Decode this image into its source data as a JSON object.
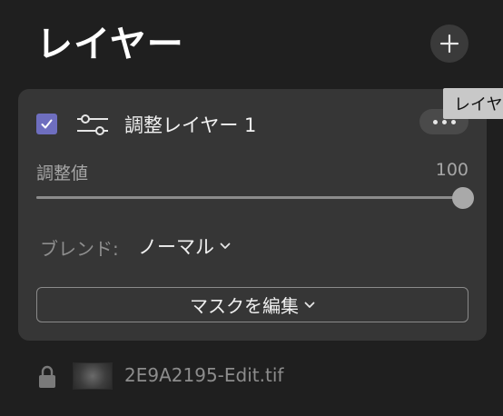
{
  "panel": {
    "title": "レイヤー"
  },
  "layer": {
    "checked": true,
    "name": "調整レイヤー 1",
    "adjustment": {
      "label": "調整値",
      "value": "100",
      "percent": 100
    },
    "blend": {
      "label": "ブレンド:",
      "value": "ノーマル"
    },
    "mask_button": "マスクを編集"
  },
  "base_layer": {
    "file_name": "2E9A2195-Edit.tif",
    "locked": true
  },
  "tooltip": {
    "text": "レイヤ"
  },
  "icons": {
    "add": "plus-icon",
    "more": "ellipsis-icon",
    "adjust": "sliders-icon",
    "lock": "lock-icon",
    "chevron": "chevron-down-icon"
  },
  "colors": {
    "background": "#1f1f1f",
    "card": "#363636",
    "checkbox_accent": "#6e6ebf",
    "tooltip_bg": "#c8c8c8"
  }
}
